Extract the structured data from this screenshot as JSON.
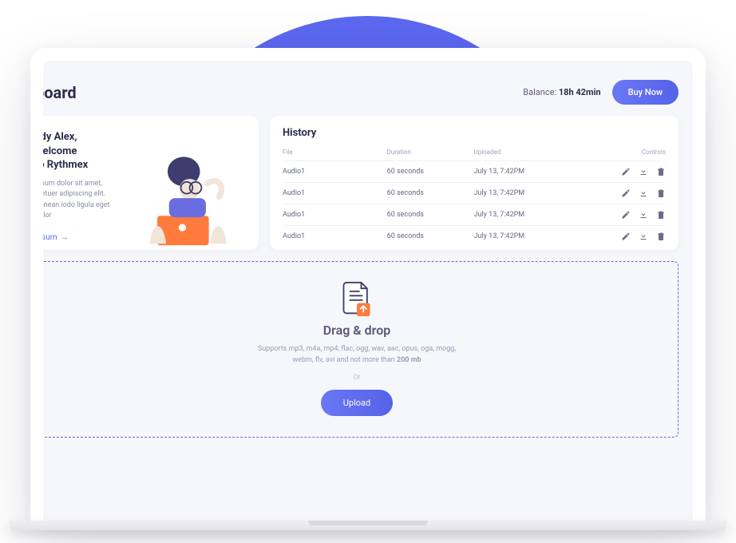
{
  "header": {
    "title": "board",
    "balance_label": "Balance: ",
    "balance_value": "18h 42min",
    "buy_label": "Buy Now"
  },
  "welcome": {
    "heading": "vdy Alex, welcome\n  to Rythmex",
    "body": "ipsum dolor sit amet, ctetuer adipiscing elit. Aenean iodo ligula eget dolor",
    "link_text": " ipsum"
  },
  "history": {
    "title": "History",
    "columns": [
      "File",
      "Duration",
      "Uploaded",
      "Controls"
    ],
    "rows": [
      {
        "file": "Audio1",
        "duration": "60 seconds",
        "uploaded": "July 13, 7:42PM"
      },
      {
        "file": "Audio1",
        "duration": "60 seconds",
        "uploaded": "July 13, 7:42PM"
      },
      {
        "file": "Audio1",
        "duration": "60 seconds",
        "uploaded": "July 13, 7:42PM"
      },
      {
        "file": "Audio1",
        "duration": "60 seconds",
        "uploaded": "July 13, 7:42PM"
      }
    ]
  },
  "drop": {
    "title": "Drag & drop",
    "body_pre": "Supports mp3, m4a, mp4, flac, ogg, wav, aac, opus, oga, mogg, webm, flv, avi and not more than ",
    "body_bold": "200 mb",
    "or": "Or",
    "upload_label": "Upload"
  },
  "colors": {
    "accent": "#5b68f0",
    "accent_gradient_from": "#6a78f5",
    "accent_gradient_to": "#5562e8",
    "orange": "#ff7a3d",
    "text_dark": "#2a2d4a",
    "text_muted": "#8a8da5"
  }
}
